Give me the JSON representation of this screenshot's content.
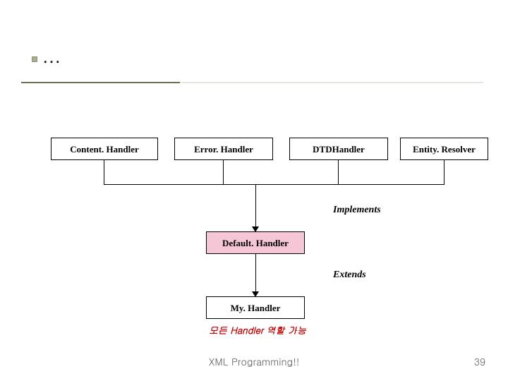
{
  "page": {
    "number": "39"
  },
  "title": "…",
  "footer": "XML Programming!!",
  "boxes": {
    "content_handler": "Content. Handler",
    "error_handler": "Error. Handler",
    "dtd_handler": "DTDHandler",
    "entity_resolver": "Entity. Resolver",
    "default_handler": "Default. Handler",
    "my_handler": "My. Handler"
  },
  "labels": {
    "implements": "Implements",
    "extends": "Extends",
    "note": "모든 Handler 역할 가능"
  }
}
